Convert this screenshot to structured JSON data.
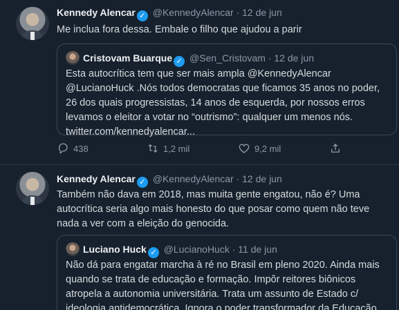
{
  "tweets": [
    {
      "author": {
        "name": "Kennedy Alencar",
        "handle": "@KennedyAlencar",
        "date": "· 12 de jun",
        "verified_icon": "verified-badge-icon",
        "avatar_icon": "profile-avatar"
      },
      "text": "Me inclua fora dessa. Embale o filho que ajudou a parir",
      "quote": {
        "author": {
          "name": "Cristovam Buarque",
          "handle": "@Sen_Cristovam",
          "date": "· 12 de jun",
          "avatar_icon": "profile-avatar"
        },
        "text": "Esta autocrítica tem que ser mais ampla @KennedyAlencar @LucianoHuck .Nós todos democratas que ficamos 35 anos no poder, 26 dos quais progressistas, 14 anos de esquerda, por nossos erros levamos o eleitor a votar no “outrismo”: qualquer um menos nós. twitter.com/kennedyalencar..."
      },
      "actions": {
        "reply_count": "438",
        "retweet_count": "1,2 mil",
        "like_count": "9,2 mil",
        "reply_icon": "reply-icon",
        "retweet_icon": "retweet-icon",
        "like_icon": "heart-icon",
        "share_icon": "share-icon"
      }
    },
    {
      "author": {
        "name": "Kennedy Alencar",
        "handle": "@KennedyAlencar",
        "date": "· 12 de jun",
        "verified_icon": "verified-badge-icon",
        "avatar_icon": "profile-avatar"
      },
      "text": "Também não dava em 2018, mas muita gente engatou, não é? Uma autocrítica seria algo mais honesto do que posar como quem não teve nada a ver com a eleição do genocida.",
      "quote": {
        "author": {
          "name": "Luciano Huck",
          "handle": "@LucianoHuck",
          "date": "· 11 de jun",
          "avatar_icon": "profile-avatar"
        },
        "text": "Não dá para engatar marcha à ré no Brasil em pleno 2020. Ainda mais quando se trata de educação e formação. Impôr reitores biônicos atropela a autonomia universitária. Trata um assunto de Estado c/ ideologia antidemocrática. Ignora o poder transformador da Educação."
      }
    }
  ],
  "colors": {
    "background": "#16212d",
    "text": "#d9dde1",
    "muted": "#8b98a5",
    "verified": "#1d9bf0",
    "border": "#3a4654"
  }
}
